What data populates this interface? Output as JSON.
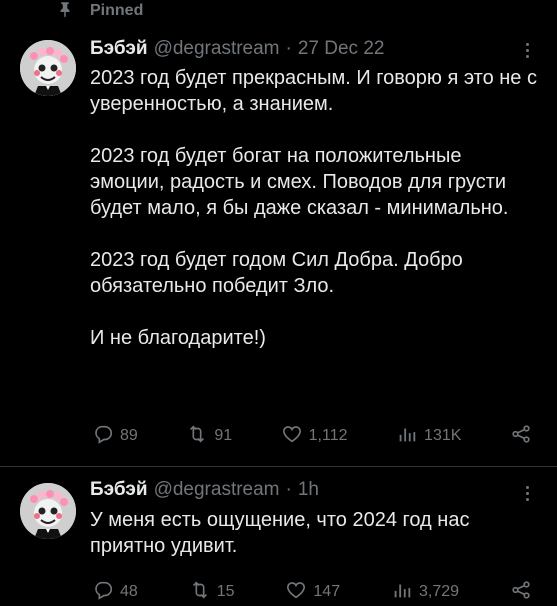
{
  "pinned_label": "Pinned",
  "tweets": [
    {
      "name": "Бэбэй",
      "handle": "@degrastream",
      "separator": "·",
      "time": "27 Dec 22",
      "text": "2023 год будет прекрасным. И говорю я это не с уверенностью, а знанием.\n\n2023 год будет богат на положительные эмоции, радость и смех. Поводов для грусти будет мало, я бы даже сказал - минимально.\n\n2023 год будет годом Сил Добра. Добро обязательно победит Зло.\n\nИ не благодарите!)",
      "replies": "89",
      "retweets": "91",
      "likes": "1,112",
      "views": "131K"
    },
    {
      "name": "Бэбэй",
      "handle": "@degrastream",
      "separator": "·",
      "time": "1h",
      "text": "У меня есть ощущение, что 2024 год нас приятно удивит.",
      "replies": "48",
      "retweets": "15",
      "likes": "147",
      "views": "3,729"
    }
  ],
  "icons": {
    "pin": "pin-icon",
    "more": "more-icon",
    "reply": "reply-icon",
    "retweet": "retweet-icon",
    "like": "heart-icon",
    "views": "views-icon",
    "share": "share-icon"
  },
  "colors": {
    "background": "#000000",
    "text": "#e7e9ea",
    "secondary": "#71767b",
    "divider": "#2f3336"
  }
}
